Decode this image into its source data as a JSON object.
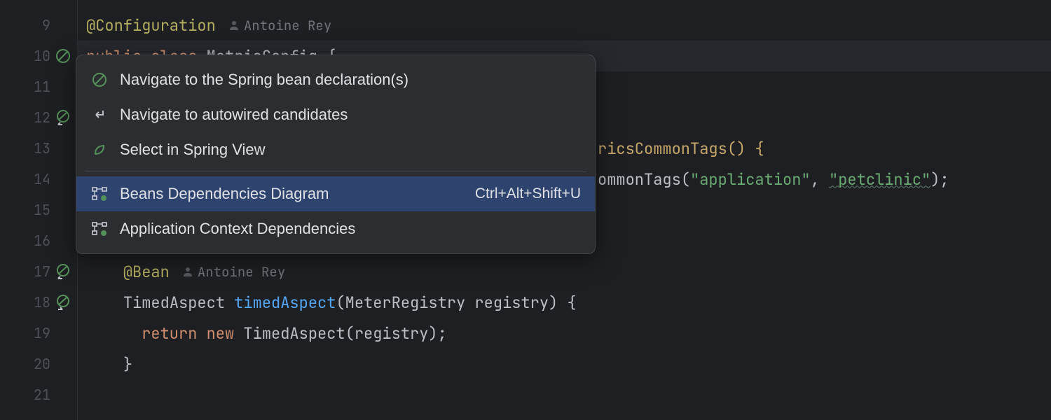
{
  "gutter": {
    "lines": [
      9,
      10,
      11,
      12,
      13,
      14,
      15,
      16,
      17,
      18,
      19,
      20,
      21
    ]
  },
  "code": {
    "line9": {
      "annotation": "@Configuration",
      "author": "Antoine Rey"
    },
    "line10": {
      "kw1": "public",
      "kw2": "class",
      "cls": "MetricConfig",
      "brace": " {"
    },
    "line13": {
      "tail": "ricsCommonTags() {"
    },
    "line14": {
      "tail_a": "ommonTags(",
      "str1": "\"application\"",
      "comma": ", ",
      "str2": "\"petclinic\"",
      "tail_b": ");"
    },
    "line17": {
      "annotation": "@Bean",
      "author": "Antoine Rey"
    },
    "line18": {
      "type": "TimedAspect ",
      "method": "timedAspect",
      "sig_a": "(MeterRegistry registry) {"
    },
    "line19": {
      "kw_return": "return ",
      "kw_new": "new ",
      "call": "TimedAspect(registry);"
    },
    "line20": {
      "brace": "}"
    }
  },
  "popup": {
    "items": [
      {
        "label": "Navigate to the Spring bean declaration(s)",
        "icon": "spring-circle",
        "selected": false
      },
      {
        "label": "Navigate to autowired candidates",
        "icon": "arrow-return",
        "selected": false
      },
      {
        "label": "Select in Spring View",
        "icon": "leaf",
        "selected": false
      }
    ],
    "items2": [
      {
        "label": "Beans Dependencies Diagram",
        "icon": "diagram",
        "shortcut": "Ctrl+Alt+Shift+U",
        "selected": true
      },
      {
        "label": "Application Context Dependencies",
        "icon": "diagram",
        "selected": false
      }
    ]
  }
}
